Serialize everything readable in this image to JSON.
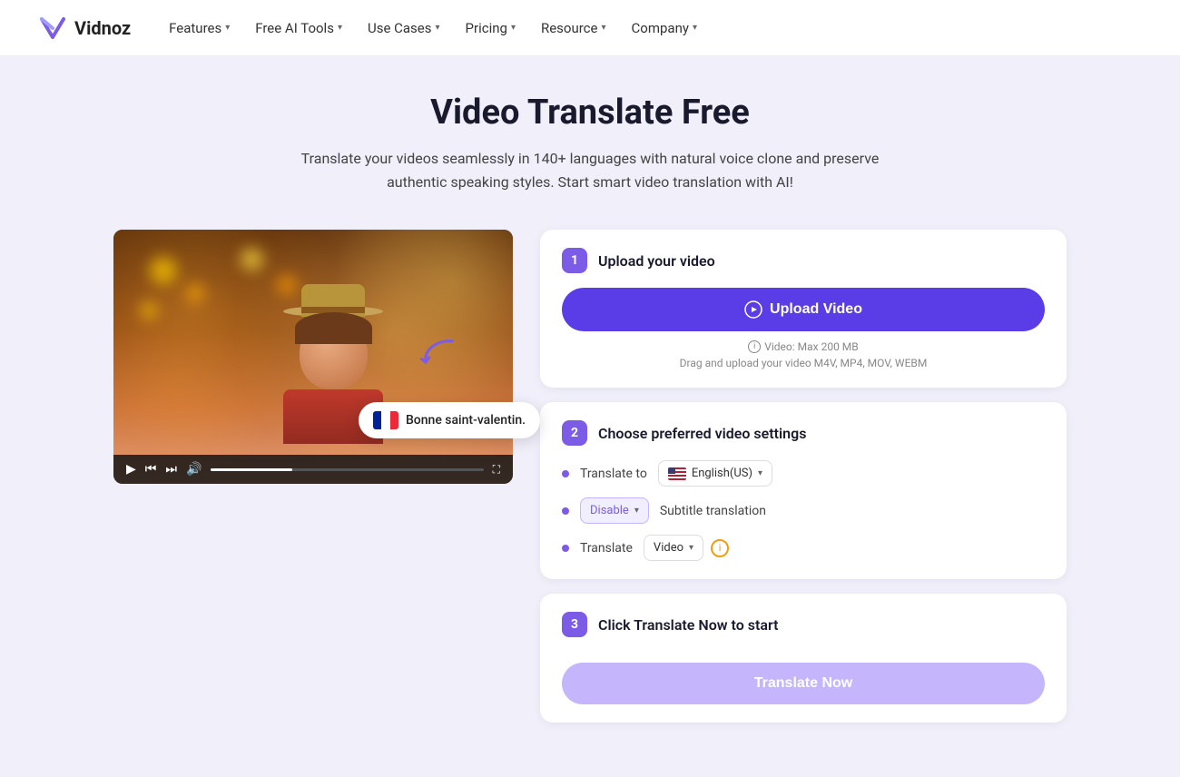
{
  "brand": {
    "name": "Vidnoz"
  },
  "nav": {
    "items": [
      {
        "label": "Features",
        "hasDropdown": true
      },
      {
        "label": "Free AI Tools",
        "hasDropdown": true
      },
      {
        "label": "Use Cases",
        "hasDropdown": true
      },
      {
        "label": "Pricing",
        "hasDropdown": true
      },
      {
        "label": "Resource",
        "hasDropdown": true
      },
      {
        "label": "Company",
        "hasDropdown": true
      }
    ]
  },
  "hero": {
    "title": "Video Translate Free",
    "subtitle": "Translate your videos seamlessly in 140+ languages with natural voice clone and preserve authentic speaking styles. Start smart video translation with AI!"
  },
  "steps": {
    "step1": {
      "number": "1",
      "title": "Upload your video",
      "upload_button": "Upload Video",
      "size_label": "Video: Max 200 MB",
      "format_label": "Drag and upload your video M4V, MP4, MOV, WEBM"
    },
    "step2": {
      "number": "2",
      "title": "Choose preferred video settings",
      "translate_to_label": "Translate to",
      "language": "English(US)",
      "subtitle_label": "Subtitle translation",
      "subtitle_option": "Disable",
      "translate_label": "Translate",
      "translate_option": "Video"
    },
    "step3": {
      "number": "3",
      "title": "Click Translate Now to start",
      "button_label": "Translate Now"
    }
  },
  "video": {
    "subtitle_text": "Bonne saint-valentin."
  }
}
